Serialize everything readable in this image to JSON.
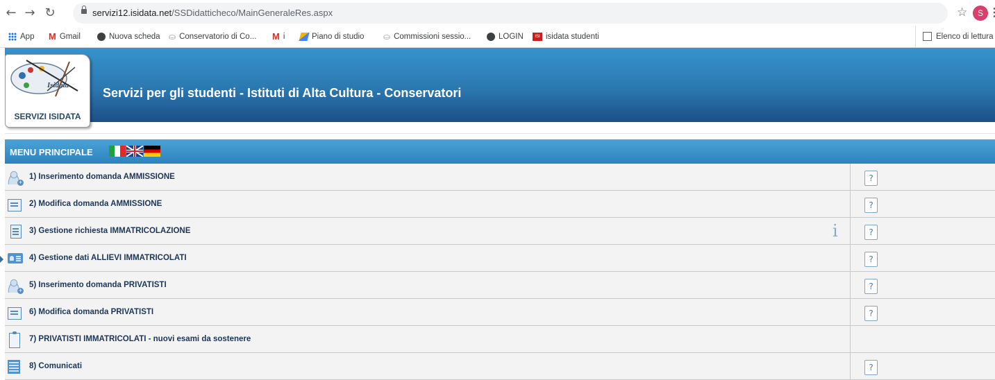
{
  "browser": {
    "url_host": "servizi12.isidata.net",
    "url_path": "/SSDidatticheco/MainGeneraleRes.aspx",
    "profile_initial": "S",
    "back_icon": "arrow-left-icon",
    "forward_icon": "arrow-right-icon",
    "reload_icon": "reload-icon"
  },
  "bookmarks": [
    {
      "label": "App",
      "icon": "apps-icon"
    },
    {
      "label": "Gmail",
      "icon": "gmail-icon"
    },
    {
      "label": "Nuova scheda",
      "icon": "globe-icon"
    },
    {
      "label": "Conservatorio di Co...",
      "icon": "conservatorio-icon"
    },
    {
      "label": "i",
      "icon": "gmail-icon"
    },
    {
      "label": "Piano di studio",
      "icon": "pen-icon"
    },
    {
      "label": "Commissioni sessio...",
      "icon": "conservatorio-icon"
    },
    {
      "label": "LOGIN",
      "icon": "globe-icon"
    },
    {
      "label": "isidata studenti",
      "icon": "isidata-icon"
    }
  ],
  "reading_list": "Elenco di lettura",
  "header": {
    "logo_caption": "SERVIZI ISIDATA",
    "logo_brand": "Isidata",
    "title": "Servizi per gli studenti - Istituti di Alta Cultura - Conservatori"
  },
  "menu": {
    "title": "MENU PRINCIPALE",
    "items": [
      {
        "label": "1) Inserimento domanda AMMISSIONE",
        "icon": "user-add-icon",
        "help": true,
        "info": false
      },
      {
        "label": "2) Modifica domanda AMMISSIONE",
        "icon": "document-edit-icon",
        "help": true,
        "info": false
      },
      {
        "label": "3) Gestione richiesta IMMATRICOLAZIONE",
        "icon": "list-icon",
        "help": true,
        "info": true
      },
      {
        "label": "4) Gestione dati ALLIEVI IMMATRICOLATI",
        "icon": "id-card-icon",
        "help": true,
        "info": false
      },
      {
        "label": "5) Inserimento domanda PRIVATISTI",
        "icon": "user-add-icon",
        "help": true,
        "info": false
      },
      {
        "label": "6) Modifica domanda PRIVATISTI",
        "icon": "document-edit-icon",
        "help": true,
        "info": false
      },
      {
        "label": "7) PRIVATISTI IMMATRICOLATI - nuovi esami da sostenere",
        "icon": "clipboard-icon",
        "help": false,
        "info": false
      },
      {
        "label": "8) Comunicati",
        "icon": "grid-icon",
        "help": true,
        "info": false
      }
    ],
    "help_glyph": "?",
    "info_glyph": "i"
  }
}
